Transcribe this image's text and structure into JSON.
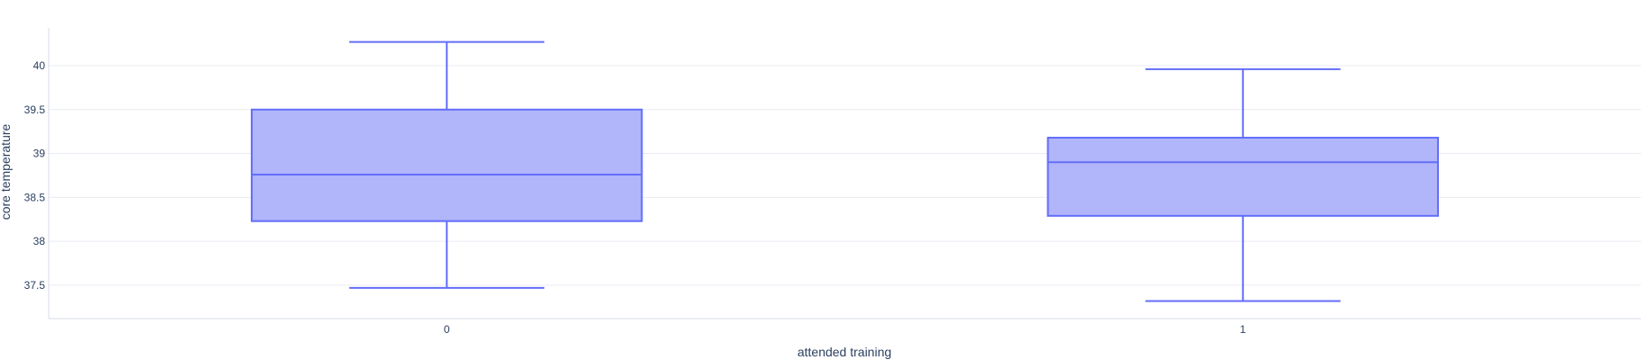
{
  "chart_data": {
    "type": "box",
    "title": "",
    "xlabel": "attended training",
    "ylabel": "core temperature",
    "categories": [
      "0",
      "1"
    ],
    "boxes": [
      {
        "category": "0",
        "lowerfence": 37.47,
        "q1": 38.23,
        "median": 38.76,
        "q3": 39.5,
        "upperfence": 40.27
      },
      {
        "category": "1",
        "lowerfence": 37.32,
        "q1": 38.29,
        "median": 38.9,
        "q3": 39.18,
        "upperfence": 39.96
      }
    ],
    "yticks": [
      "37.5",
      "38",
      "38.5",
      "39",
      "39.5",
      "40"
    ],
    "ylim": [
      37.12,
      40.43
    ],
    "grid": true,
    "legend": "none",
    "colors": {
      "line": "#636efa",
      "fill": "#b1b5f9",
      "grid": "#e9ecf3",
      "axis": "#d7dbe8",
      "text": "#2a3f5f"
    }
  }
}
